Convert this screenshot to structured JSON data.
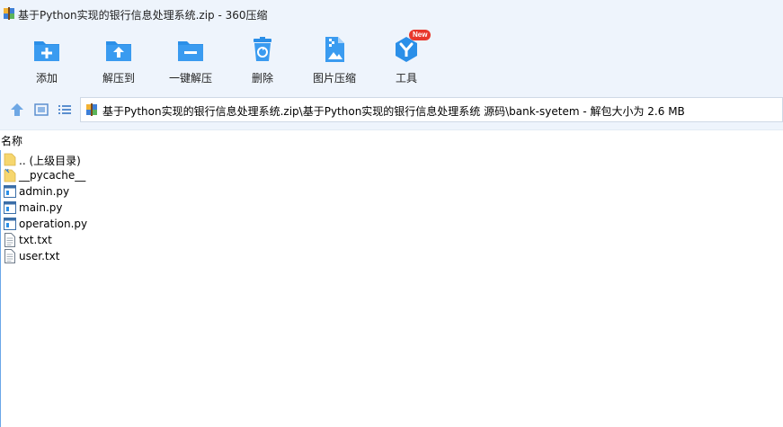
{
  "window": {
    "title": "基于Python实现的银行信息处理系统.zip - 360压缩"
  },
  "toolbar": {
    "items": [
      {
        "label": "添加",
        "icon": "add-icon"
      },
      {
        "label": "解压到",
        "icon": "extract-to-icon"
      },
      {
        "label": "一键解压",
        "icon": "one-click-extract-icon"
      },
      {
        "label": "删除",
        "icon": "delete-icon"
      },
      {
        "label": "图片压缩",
        "icon": "image-compress-icon"
      },
      {
        "label": "工具",
        "icon": "tools-icon",
        "badge": "New"
      }
    ]
  },
  "navbar": {
    "path": "基于Python实现的银行信息处理系统.zip\\基于Python实现的银行信息处理系统 源码\\bank-syetem - 解包大小为 2.6 MB"
  },
  "list": {
    "column_name": "名称",
    "files": [
      {
        "name": ".. (上级目录)",
        "icon": "parent-folder-icon"
      },
      {
        "name": "__pycache__",
        "icon": "folder-icon"
      },
      {
        "name": "admin.py",
        "icon": "python-file-icon"
      },
      {
        "name": "main.py",
        "icon": "python-file-icon"
      },
      {
        "name": "operation.py",
        "icon": "python-file-icon"
      },
      {
        "name": "txt.txt",
        "icon": "text-file-icon"
      },
      {
        "name": "user.txt",
        "icon": "text-file-icon"
      }
    ]
  },
  "colors": {
    "accent_blue": "#2b8fe8",
    "toolbar_bg": "#eef4fc",
    "badge_red": "#e8372c",
    "folder_yellow": "#f6d66e"
  }
}
